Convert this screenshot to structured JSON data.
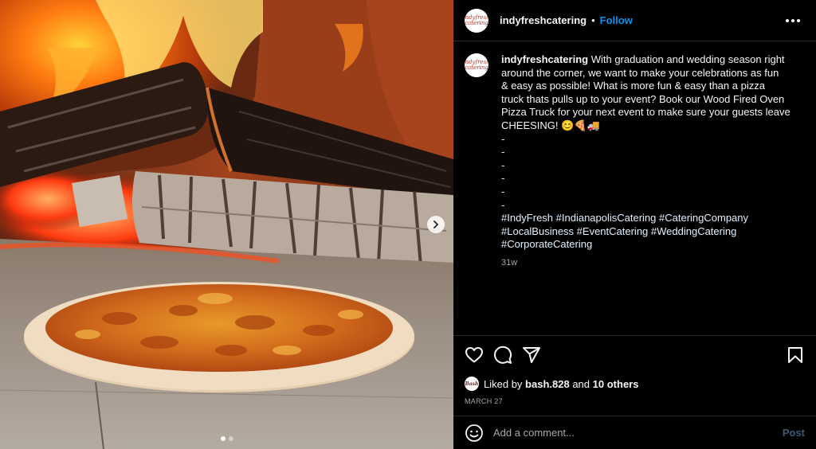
{
  "post": {
    "account_avatar_text": "indyfresh catering",
    "username": "indyfreshcatering",
    "separator": "•",
    "follow_label": "Follow",
    "caption_lines": [
      "With graduation and wedding season right",
      "around the corner, we want to make your celebrations as fun",
      "& easy as possible! What is more fun & easy than a pizza",
      "truck thats pulls up to your event? Book our Wood Fired Oven",
      "Pizza Truck for your next event to make sure your guests leave",
      "CHEESING! 😊🍕🚚"
    ],
    "dash_lines": [
      "-",
      "-",
      "-",
      "-",
      "-",
      "-"
    ],
    "hashtag_lines": [
      "#IndyFresh #IndianapolisCatering #CateringCompany",
      "#LocalBusiness #EventCatering #WeddingCatering",
      "#CorporateCatering"
    ],
    "relative_time": "31w"
  },
  "engagement": {
    "liker_avatar_text": "Bash",
    "liked_by_prefix": "Liked by",
    "liker": "bash.828",
    "and_label": "and",
    "others": "10 others",
    "date": "MARCH 27"
  },
  "comment_box": {
    "placeholder": "Add a comment...",
    "post_label": "Post"
  },
  "carousel": {
    "slide_count": 2,
    "active_index": 0
  },
  "icons": {
    "like": "heart-icon",
    "comment": "comment-bubble-icon",
    "share": "paper-plane-icon",
    "save": "bookmark-icon",
    "more": "more-horizontal-icon",
    "emoji": "emoji-smile-icon",
    "next": "chevron-right-icon"
  },
  "colors": {
    "background": "#000000",
    "text": "#f5f5f5",
    "secondary_text": "#a8a8a8",
    "follow_blue": "#0095f6",
    "hashtag": "#e0f1ff",
    "post_disabled": "#3b5a73",
    "divider": "#262626"
  }
}
